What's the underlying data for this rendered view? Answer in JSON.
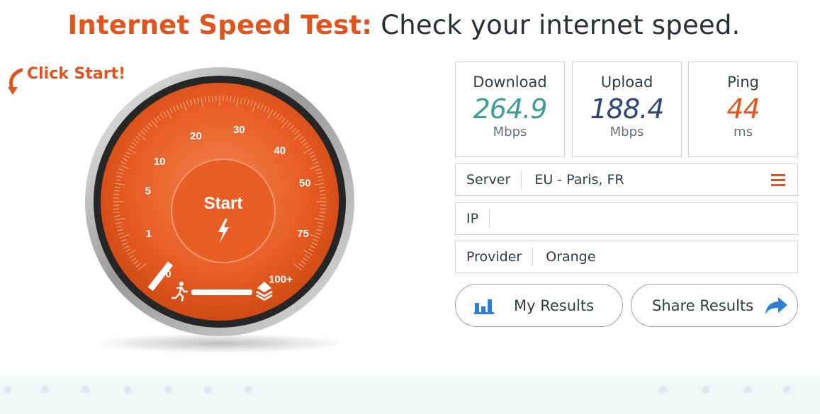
{
  "header": {
    "title_accent": "Internet Speed Test:",
    "title_rest": "Check your internet speed."
  },
  "hint": {
    "text": "Click Start!",
    "icon": "curved-arrow-down-icon"
  },
  "gauge": {
    "start_label": "Start",
    "ticks": [
      "0",
      "1",
      "5",
      "10",
      "20",
      "30",
      "40",
      "50",
      "75",
      "100+"
    ],
    "progress": 0,
    "colors": {
      "face": "#e0541d",
      "face_light": "#f07a45",
      "bezel": "#2b2b2b",
      "chrome": "#c9c9c9"
    }
  },
  "metrics": [
    {
      "label": "Download",
      "value": "264.9",
      "unit": "Mbps",
      "color": "#3a9e9a"
    },
    {
      "label": "Upload",
      "value": "188.4",
      "unit": "Mbps",
      "color": "#2d4677"
    },
    {
      "label": "Ping",
      "value": "44",
      "unit": "ms",
      "color": "#e0541d"
    }
  ],
  "info": {
    "server": {
      "label": "Server",
      "value": "EU - Paris, FR",
      "icon": "menu-icon"
    },
    "ip": {
      "label": "IP",
      "value": ""
    },
    "provider": {
      "label": "Provider",
      "value": "Orange"
    }
  },
  "actions": {
    "my_results": {
      "label": "My Results",
      "icon": "bar-chart-icon"
    },
    "share_results": {
      "label": "Share Results",
      "icon": "share-arrow-icon"
    }
  },
  "colors": {
    "accent": "#e0541d",
    "text": "#2a2f36",
    "border": "#d0d4d8",
    "link_blue": "#2d7fd3"
  }
}
